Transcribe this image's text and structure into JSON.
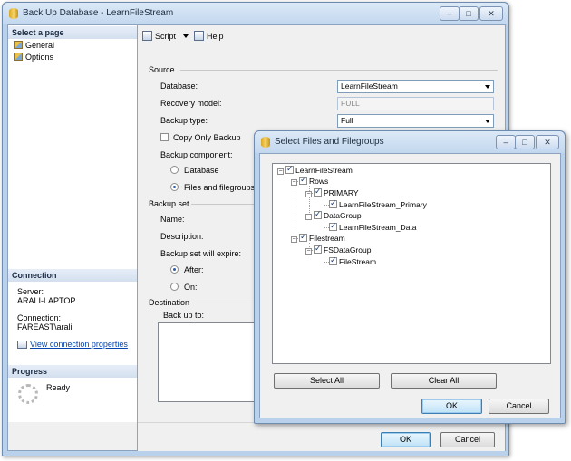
{
  "main_window": {
    "title": "Back Up Database - LearnFileStream",
    "controls": {
      "minimize": "–",
      "maximize": "□",
      "close": "✕"
    }
  },
  "left_panel": {
    "select_page_header": "Select a page",
    "pages": [
      "General",
      "Options"
    ],
    "connection_header": "Connection",
    "server_label": "Server:",
    "server_value": "ARALI-LAPTOP",
    "connection_label": "Connection:",
    "connection_value": "FAREAST\\arali",
    "view_link": "View connection properties",
    "progress_header": "Progress",
    "progress_status": "Ready"
  },
  "toolbar": {
    "script_label": "Script",
    "help_label": "Help"
  },
  "source": {
    "header": "Source",
    "database_label": "Database:",
    "database_value": "LearnFileStream",
    "recovery_label": "Recovery model:",
    "recovery_value": "FULL",
    "backup_type_label": "Backup type:",
    "backup_type_value": "Full",
    "copy_only_label": "Copy Only Backup",
    "backup_component_label": "Backup component:",
    "component_database": "Database",
    "component_files": "Files and filegroups:"
  },
  "backup_set": {
    "header": "Backup set",
    "name_label": "Name:",
    "description_label": "Description:",
    "expire_label": "Backup set will expire:",
    "after_label": "After:",
    "on_label": "On:"
  },
  "destination": {
    "header": "Destination",
    "backup_to_label": "Back up to:"
  },
  "main_buttons": {
    "ok": "OK",
    "cancel": "Cancel"
  },
  "dialog": {
    "title": "Select Files and Filegroups",
    "tree": {
      "root": "LearnFileStream",
      "rows": "Rows",
      "primary": "PRIMARY",
      "primary_file": "LearnFileStream_Primary",
      "datagroup": "DataGroup",
      "data_file": "LearnFileStream_Data",
      "filestream": "Filestream",
      "fsdatagroup": "FSDataGroup",
      "fs_file": "FileStream"
    },
    "select_all": "Select All",
    "clear_all": "Clear All",
    "ok": "OK",
    "cancel": "Cancel"
  }
}
